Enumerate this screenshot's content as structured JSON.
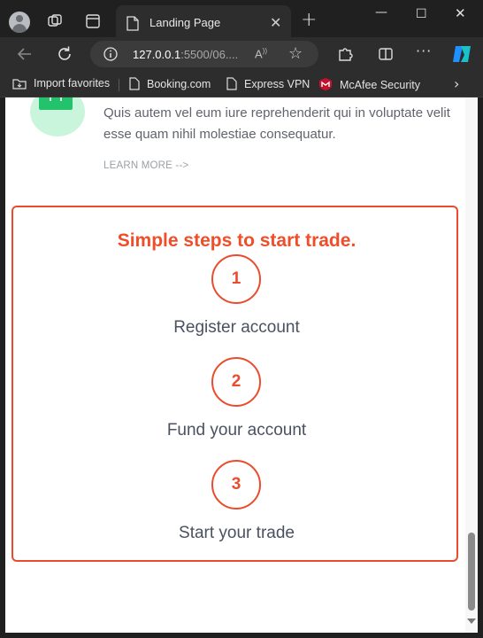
{
  "browser": {
    "tab": {
      "title": "Landing Page"
    },
    "address": {
      "host": "127.0.0.1",
      "rest": ":5500/06...."
    },
    "favorites": [
      {
        "label": "Import favorites"
      },
      {
        "label": "Booking.com"
      },
      {
        "label": "Express VPN"
      },
      {
        "label": "McAfee Security"
      }
    ],
    "icons": {
      "mcafee_color": "#c8102e",
      "copilot_colors": [
        "#1e90ff",
        "#19c2c9"
      ]
    }
  },
  "page": {
    "feature": {
      "description": "Quis autem vel eum iure reprehenderit qui in voluptate velit esse quam nihil molestiae consequatur.",
      "link": "LEARN MORE -->",
      "icon_color": "#23c36b"
    },
    "steps": {
      "title": "Simple steps to start trade.",
      "accent_color": "#ea4c2d",
      "items": [
        {
          "number": "1",
          "label": "Register account"
        },
        {
          "number": "2",
          "label": "Fund your account"
        },
        {
          "number": "3",
          "label": "Start your trade"
        }
      ]
    }
  }
}
